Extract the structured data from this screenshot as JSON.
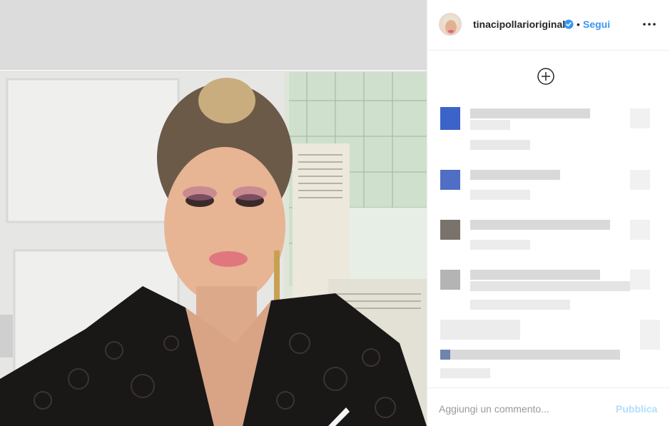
{
  "post": {
    "username": "tinacipollarioriginal",
    "separator": "•",
    "follow_label": "Segui",
    "verified": true,
    "more_icon": "more-options-icon",
    "add_icon": "add-circle-icon"
  },
  "comment_box": {
    "placeholder": "Aggiungi un commento...",
    "publish_label": "Pubblica"
  },
  "colors": {
    "accent": "#3897f0",
    "publish_disabled": "#b2dffc",
    "text": "#262626",
    "placeholder": "#999999",
    "border": "#efefef"
  }
}
